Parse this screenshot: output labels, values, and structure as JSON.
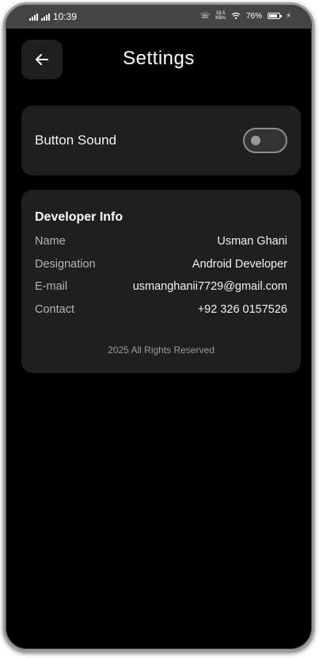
{
  "status_bar": {
    "time": "10:39",
    "battery": "76%",
    "network_speed_top": "18.5",
    "network_speed_unit": "KB/s"
  },
  "header": {
    "title": "Settings"
  },
  "sound": {
    "label": "Button Sound",
    "enabled": false
  },
  "developer": {
    "heading": "Developer Info",
    "rows": [
      {
        "key": "Name",
        "value": "Usman Ghani"
      },
      {
        "key": "Designation",
        "value": "Android Developer"
      },
      {
        "key": "E-mail",
        "value": "usmanghanii7729@gmail.com"
      },
      {
        "key": "Contact",
        "value": "+92 326 0157526"
      }
    ],
    "footer": "2025 All Rights Reserved"
  },
  "colors": {
    "background": "#000000",
    "card": "#1f1f1f",
    "status_bar": "#444444"
  }
}
